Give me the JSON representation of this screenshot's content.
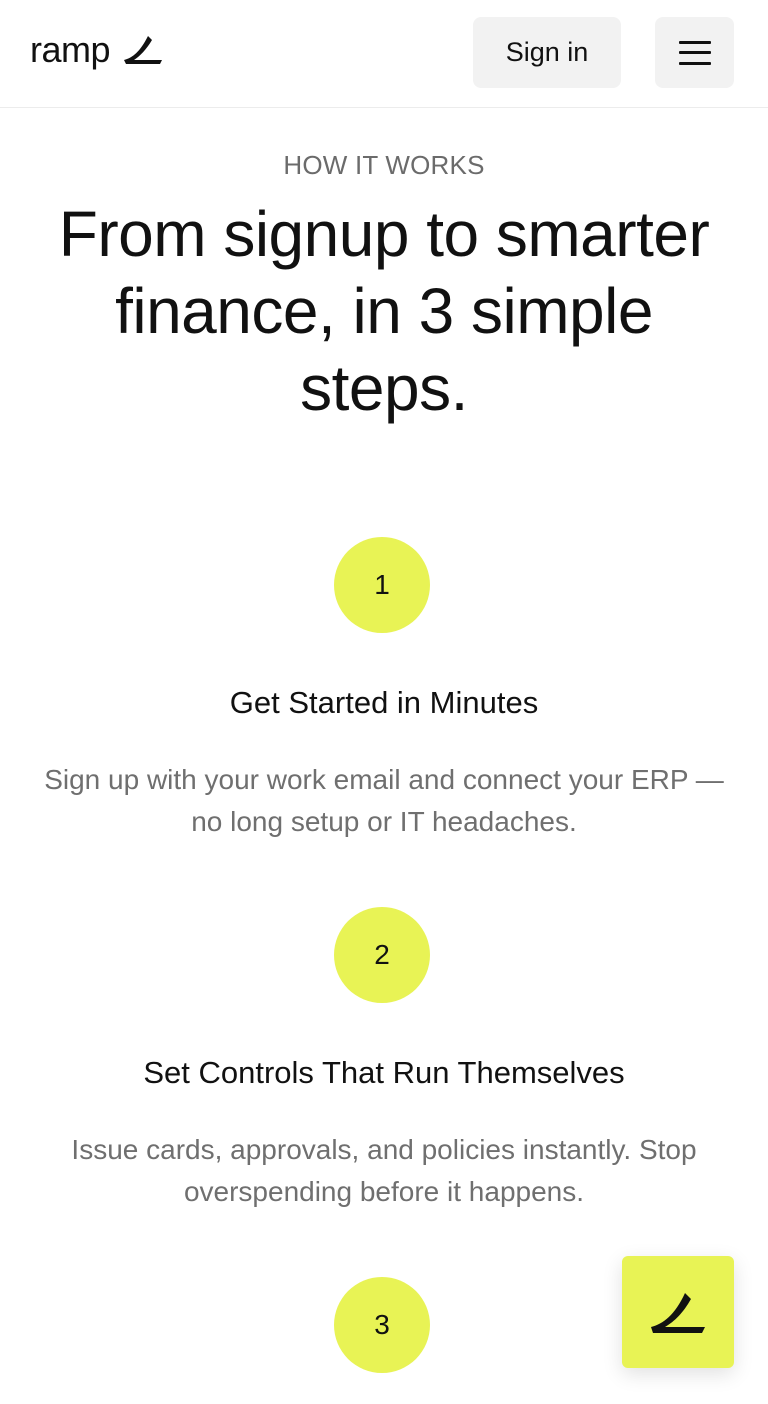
{
  "brand": {
    "name": "ramp",
    "accent_color": "#e8f355"
  },
  "header": {
    "signin_label": "Sign in",
    "menu_icon": "hamburger-menu-icon"
  },
  "hero": {
    "eyebrow": "HOW IT WORKS",
    "headline": "From signup to smarter finance, in 3 simple steps."
  },
  "steps": [
    {
      "number": "1",
      "title": "Get Started in Minutes",
      "description": "Sign up with your work email and connect your ERP — no long setup or IT headaches."
    },
    {
      "number": "2",
      "title": "Set Controls That Run Themselves",
      "description": "Issue cards, approvals, and policies instantly. Stop overspending before it happens."
    },
    {
      "number": "3"
    }
  ],
  "floating_button": {
    "icon": "ramp-logo-icon"
  }
}
